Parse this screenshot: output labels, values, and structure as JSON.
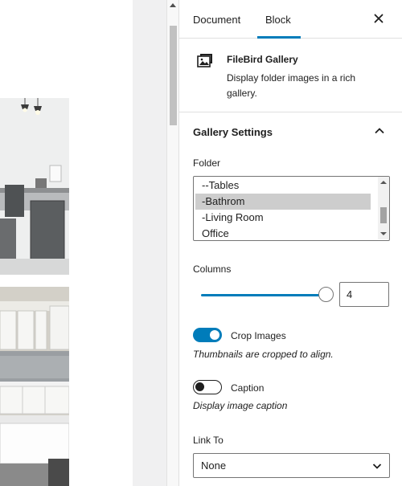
{
  "tabs": {
    "document": "Document",
    "block": "Block",
    "active": "Block"
  },
  "close_icon": "close-icon",
  "block": {
    "icon": "gallery-icon",
    "title": "FileBird Gallery",
    "description": "Display folder images in a rich gallery."
  },
  "gallery_settings": {
    "title": "Gallery Settings",
    "collapse_icon": "chevron-up-icon",
    "folder": {
      "label": "Folder",
      "options": [
        "--Tables",
        "-Bathrom",
        "-Living Room",
        "Office"
      ],
      "selected": "-Bathrom"
    },
    "columns": {
      "label": "Columns",
      "value": "4",
      "slider_fraction": 1.0
    },
    "crop_images": {
      "label": "Crop Images",
      "enabled": true,
      "help": "Thumbnails are cropped to align."
    },
    "caption": {
      "label": "Caption",
      "enabled": false,
      "help": "Display image caption"
    },
    "link_to": {
      "label": "Link To",
      "value": "None"
    }
  },
  "colors": {
    "accent": "#007cba",
    "selected_option_bg": "#cdcdcd",
    "border": "#757575"
  }
}
